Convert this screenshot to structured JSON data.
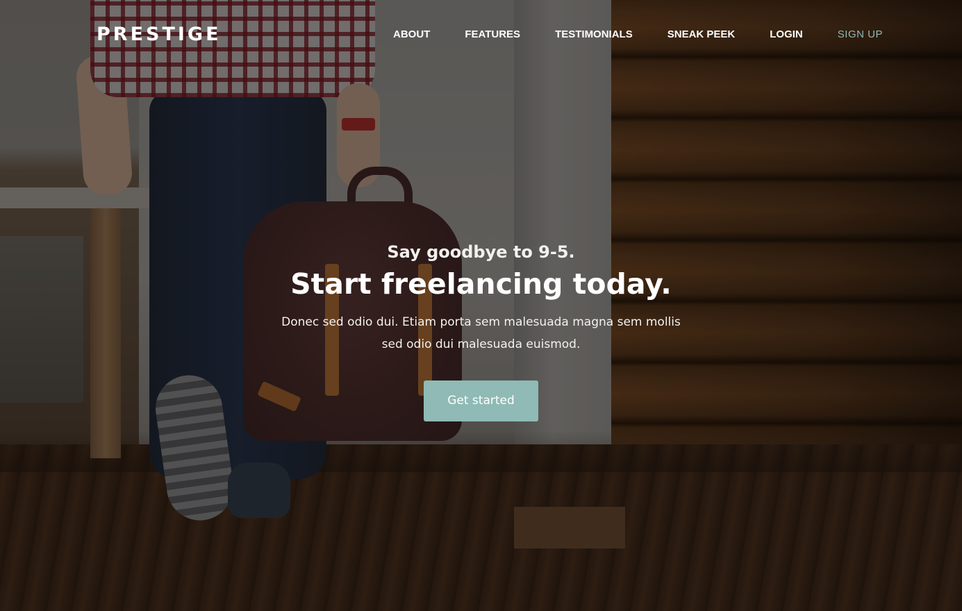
{
  "brand": {
    "logo": "PRESTIGE"
  },
  "nav": {
    "items": [
      {
        "label": "ABOUT"
      },
      {
        "label": "FEATURES"
      },
      {
        "label": "TESTIMONIALS"
      },
      {
        "label": "SNEAK PEEK"
      },
      {
        "label": "LOGIN"
      },
      {
        "label": "SIGN UP"
      }
    ]
  },
  "hero": {
    "pretitle": "Say goodbye to 9-5.",
    "title": "Start freelancing today.",
    "description": "Donec sed odio dui. Etiam porta sem malesuada magna sem mollis sed odio dui malesuada euismod.",
    "cta_label": "Get started"
  },
  "colors": {
    "accent": "#8fbab5",
    "nav_text": "#ffffff",
    "button_bg": "#8fbab5"
  }
}
